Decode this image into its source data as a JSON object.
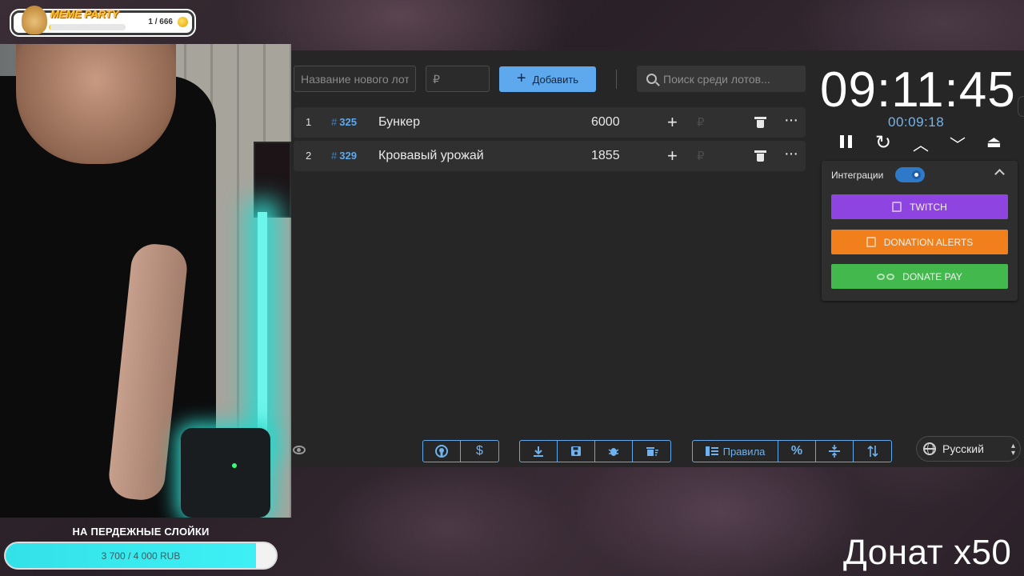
{
  "stream_badge": {
    "title": "MEME PARTY",
    "count": "1 / 666",
    "progress_fraction": 0.0015
  },
  "goal": {
    "title": "НА ПЕРДЕЖНЫЕ СЛОЙКИ",
    "label": "3 700 / 4 000 RUB",
    "current": 3700,
    "target": 4000
  },
  "add_lot": {
    "name_placeholder": "Название нового лота",
    "price_placeholder": "₽",
    "add_label": "Добавить",
    "search_placeholder": "Поиск среди лотов..."
  },
  "lots": [
    {
      "index": "1",
      "number": "325",
      "name": "Бункер",
      "amount": "6000",
      "currency": "₽"
    },
    {
      "index": "2",
      "number": "329",
      "name": "Кровавый урожай",
      "amount": "1855",
      "currency": "₽"
    }
  ],
  "bottom_toolbar": {
    "group1": [
      "github-icon",
      "$"
    ],
    "group2": [
      "download-icon",
      "save-icon",
      "bug-icon",
      "clear-icon"
    ],
    "rules_label": "Правила",
    "percent_label": "%",
    "language": "Русский"
  },
  "timer": {
    "main": "09:11:45",
    "elapsed": "00:09:18"
  },
  "integrations": {
    "label": "Интеграции",
    "enabled": true,
    "twitch": "TWITCH",
    "donation_alerts": "DONATION ALERTS",
    "donate_pay": "DONATE PAY"
  },
  "overlay_text": "Донат x50",
  "colors": {
    "accent": "#5ea8ed",
    "twitch": "#8d44e0",
    "donation_alerts": "#f17f1b",
    "donate_pay": "#43b84d",
    "goal_fill": "#32e2e8"
  }
}
